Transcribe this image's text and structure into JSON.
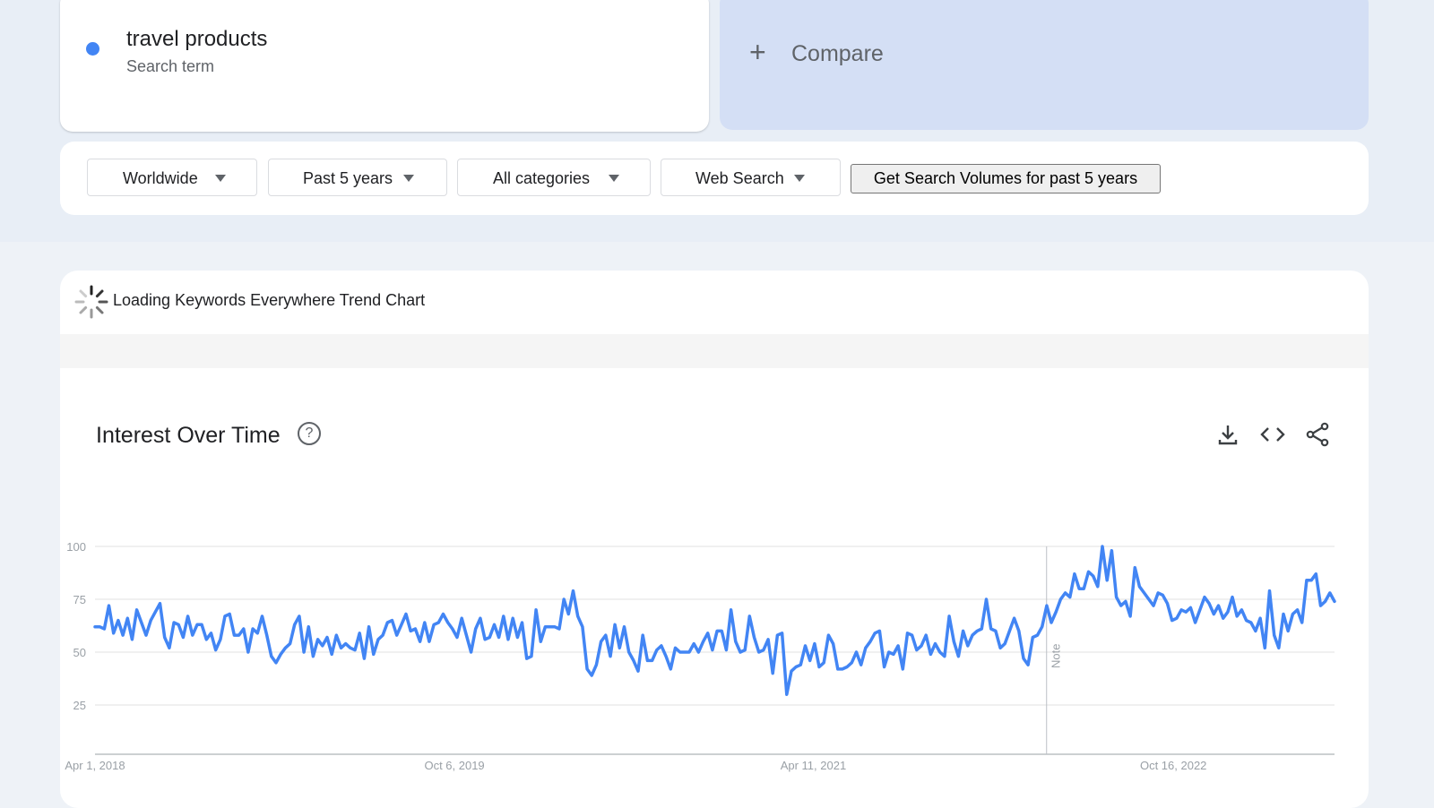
{
  "search_term": {
    "name": "travel products",
    "type": "Search term",
    "color": "#4285f4"
  },
  "compare": {
    "plus": "+",
    "label": "Compare"
  },
  "filters": {
    "region": "Worldwide",
    "time_range": "Past 5 years",
    "category": "All categories",
    "property": "Web Search",
    "volume_button": "Get Search Volumes for past 5 years"
  },
  "loading": {
    "text": "Loading Keywords Everywhere Trend Chart"
  },
  "chart_header": {
    "title": "Interest Over Time",
    "help": "?"
  },
  "icons": {
    "download": "download-icon",
    "embed": "embed-code-icon",
    "share": "share-icon",
    "help": "help-icon"
  },
  "chart_data": {
    "type": "line",
    "title": "Interest Over Time",
    "xlabel": "",
    "ylabel": "",
    "ylim": [
      0,
      100
    ],
    "yticks": [
      25,
      50,
      75,
      100
    ],
    "grid": true,
    "series_color": "#4285f4",
    "x_tick_labels": [
      "Apr 1, 2018",
      "Oct 6, 2019",
      "Apr 11, 2021",
      "Oct 16, 2022"
    ],
    "annotation": "Note",
    "series": [
      {
        "values": [
          62,
          62,
          61,
          72,
          59,
          65,
          58,
          66,
          56,
          70,
          64,
          58,
          65,
          69,
          73,
          57,
          52,
          64,
          63,
          57,
          67,
          58,
          63,
          63,
          56,
          59,
          51,
          56,
          67,
          68,
          58,
          58,
          61,
          50,
          61,
          59,
          67,
          58,
          48,
          45,
          49,
          52,
          54,
          63,
          67,
          50,
          62,
          48,
          56,
          53,
          57,
          49,
          58,
          52,
          54,
          52,
          51,
          59,
          47,
          62,
          49,
          56,
          58,
          64,
          65,
          58,
          63,
          68,
          60,
          61,
          55,
          64,
          55,
          63,
          64,
          68,
          64,
          61,
          57,
          66,
          58,
          50,
          61,
          66,
          56,
          57,
          63,
          57,
          67,
          56,
          66,
          57,
          64,
          47,
          48,
          70,
          55,
          62,
          62,
          62,
          61,
          75,
          68,
          79,
          67,
          62,
          42,
          39,
          44,
          55,
          58,
          48,
          63,
          52,
          62,
          50,
          46,
          41,
          58,
          46,
          46,
          51,
          53,
          48,
          42,
          52,
          50,
          50,
          50,
          54,
          50,
          55,
          59,
          51,
          60,
          60,
          51,
          70,
          55,
          50,
          51,
          67,
          57,
          50,
          51,
          56,
          40,
          58,
          59,
          30,
          41,
          43,
          44,
          53,
          46,
          54,
          43,
          45,
          58,
          54,
          42,
          42,
          43,
          45,
          50,
          44,
          52,
          55,
          59,
          60,
          43,
          50,
          49,
          53,
          42,
          59,
          58,
          51,
          53,
          58,
          49,
          54,
          50,
          48,
          67,
          55,
          48,
          60,
          53,
          58,
          60,
          61,
          75,
          61,
          60,
          52,
          54,
          60,
          66,
          60,
          47,
          44,
          57,
          58,
          62,
          72,
          64,
          69,
          75,
          78,
          76,
          87,
          80,
          80,
          88,
          86,
          81,
          100,
          84,
          98,
          76,
          72,
          74,
          67,
          90,
          81,
          78,
          75,
          72,
          78,
          77,
          73,
          65,
          66,
          70,
          69,
          71,
          64,
          70,
          76,
          73,
          68,
          72,
          66,
          69,
          76,
          67,
          70,
          65,
          64,
          60,
          66,
          52,
          79,
          58,
          52,
          68,
          60,
          68,
          70,
          64,
          84,
          84,
          87,
          72,
          74,
          78,
          74
        ]
      }
    ]
  }
}
